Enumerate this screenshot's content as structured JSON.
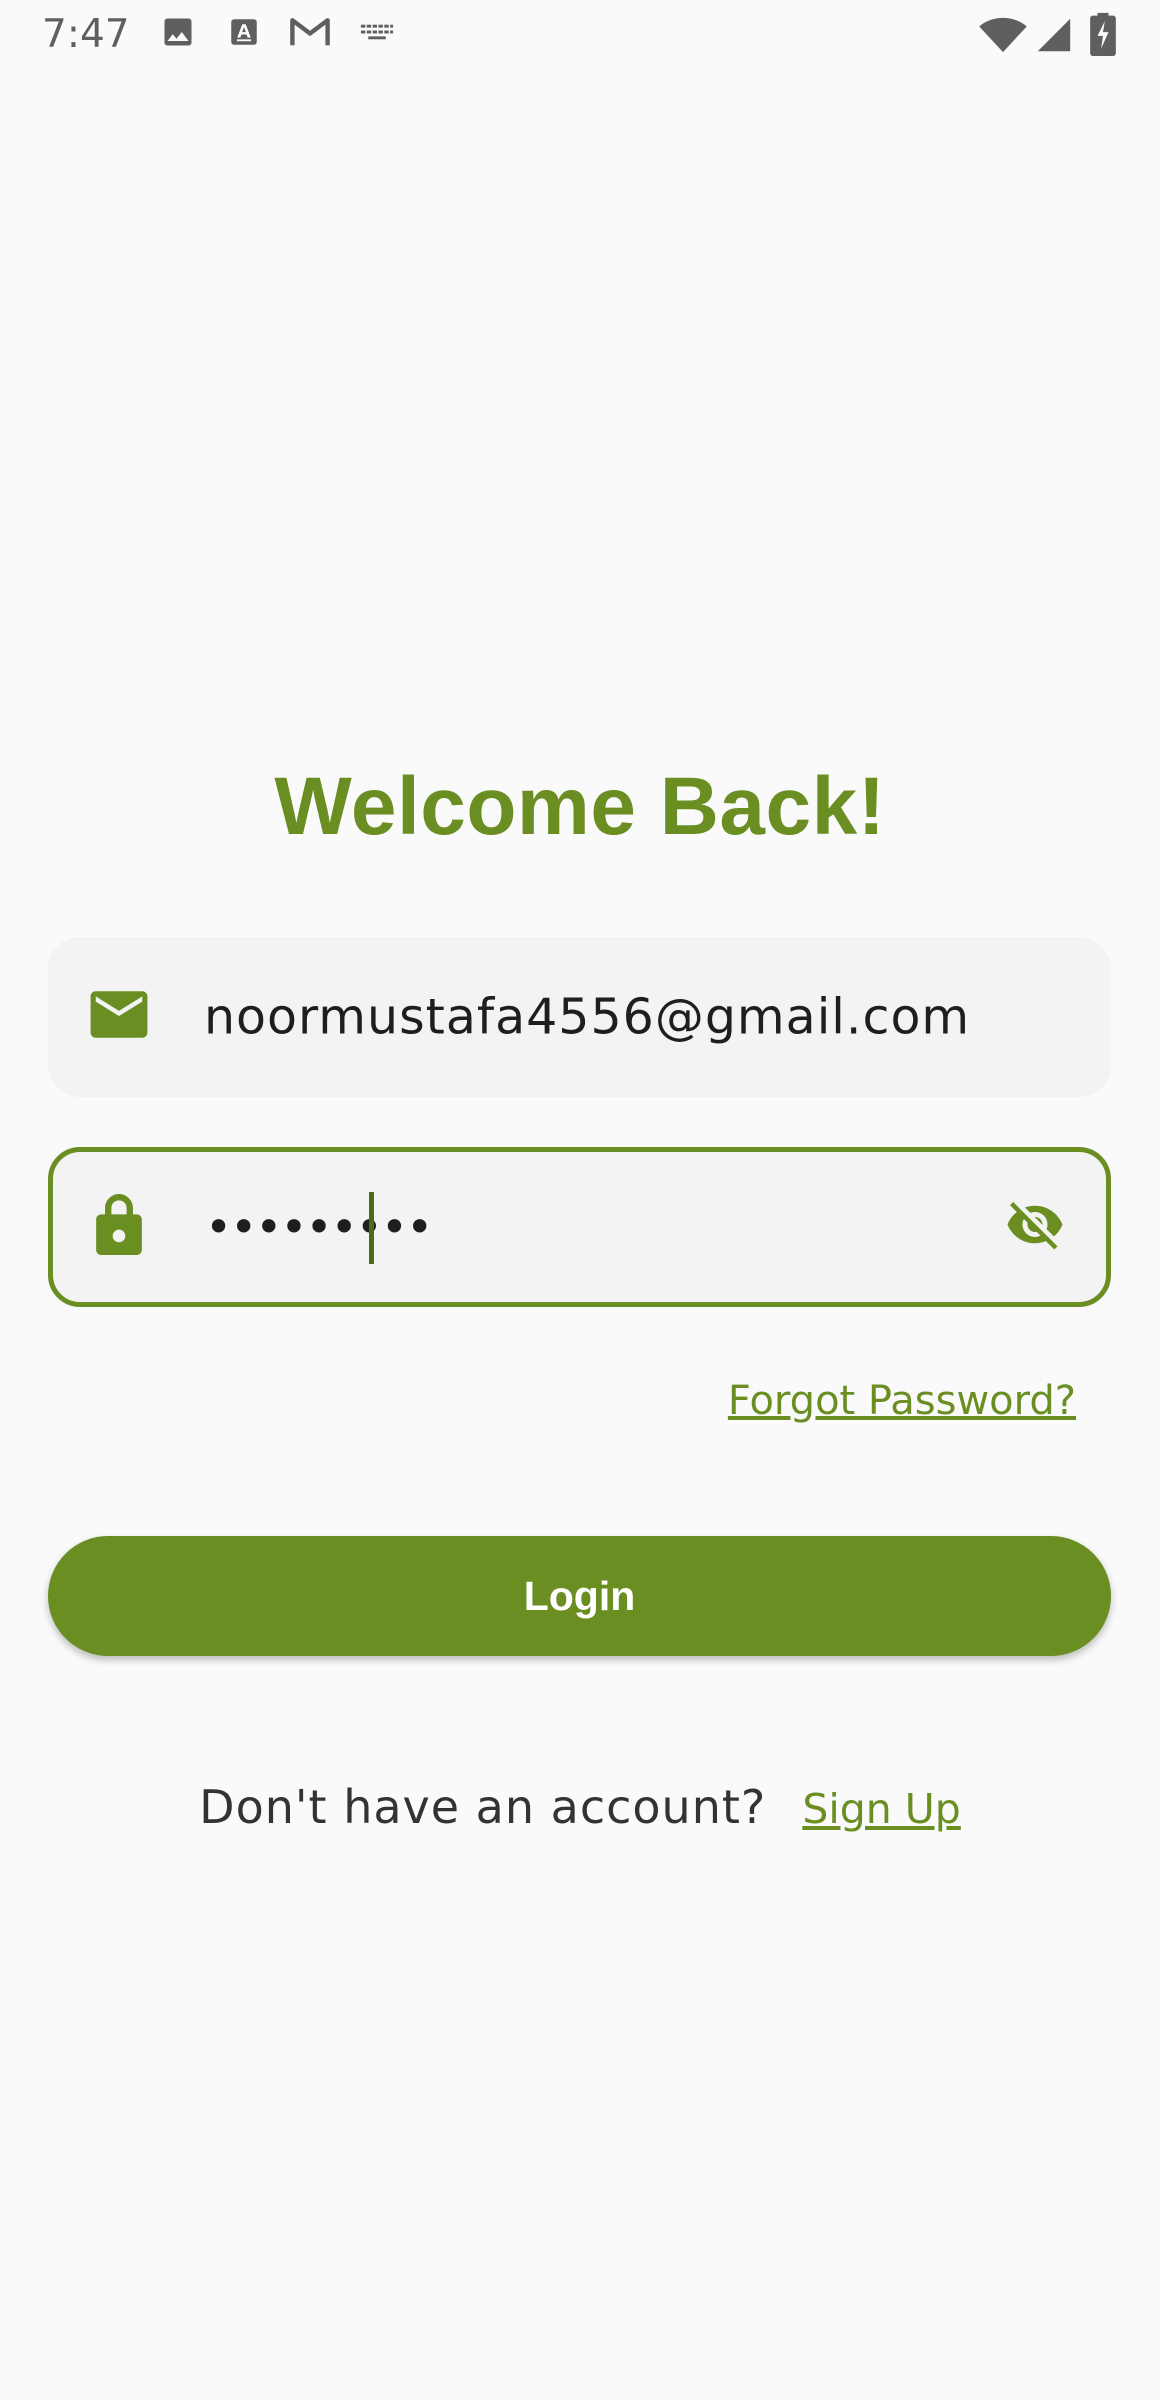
{
  "status_bar": {
    "time": "7:47",
    "left_icons": [
      "image-icon",
      "text-a-icon",
      "gmail-icon",
      "keyboard-icon"
    ],
    "right_icons": [
      "wifi-icon",
      "signal-icon",
      "battery-charging-icon"
    ]
  },
  "screen": {
    "title": "Welcome Back!",
    "email_field": {
      "icon": "email-icon",
      "value": "noormustafa4556@gmail.com"
    },
    "password_field": {
      "icon": "lock-icon",
      "value": "•••••••••",
      "visibility_icon": "visibility-off-icon"
    },
    "forgot_password_label": "Forgot Password?",
    "login_label": "Login",
    "signup_prompt": "Don't have an account?",
    "signup_label": "Sign Up"
  },
  "colors": {
    "accent": "#6b8e23",
    "background": "#fafafa",
    "field_background": "#f3f3f3",
    "status_icons": "#5f5f5f"
  }
}
